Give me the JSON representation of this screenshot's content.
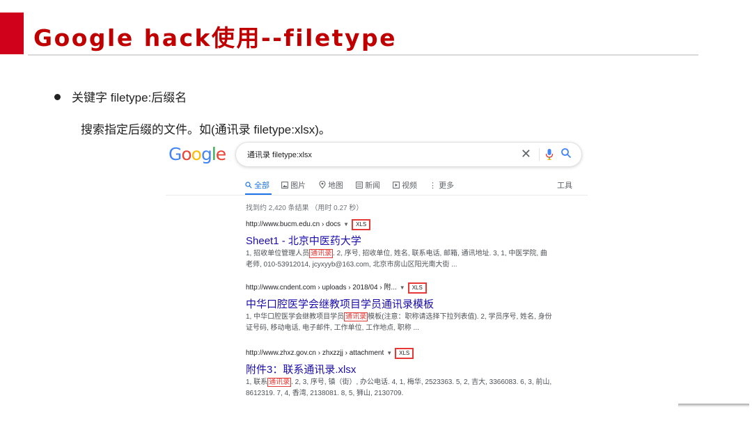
{
  "slide": {
    "title": "Google hack使用--filetype",
    "bullet": "关键字 filetype:后缀名",
    "description": "搜索指定后缀的文件。如(通讯录 filetype:xlsx)。"
  },
  "google": {
    "logo_letters": [
      {
        "ch": "G",
        "color": "#4285f4"
      },
      {
        "ch": "o",
        "color": "#ea4335"
      },
      {
        "ch": "o",
        "color": "#fbbc05"
      },
      {
        "ch": "g",
        "color": "#4285f4"
      },
      {
        "ch": "l",
        "color": "#34a853"
      },
      {
        "ch": "e",
        "color": "#ea4335"
      }
    ],
    "search": {
      "query": "通讯录 filetype:xlsx"
    },
    "tabs": [
      "全部",
      "图片",
      "地图",
      "新闻",
      "视频",
      "更多"
    ],
    "tab_icons": [
      "search-icon",
      "image-icon",
      "map-pin-icon",
      "news-icon",
      "video-icon",
      "more-icon"
    ],
    "tools": "工具",
    "stats": "找到约 2,420 条结果 （用时 0.27 秒）",
    "results": [
      {
        "url": "http://www.bucm.edu.cn › docs",
        "badge": "XLS",
        "title": "Sheet1 - 北京中医药大学",
        "snippet_before": "1, 招收单位管理人员",
        "snippet_highlight": "通讯录",
        "snippet_after": ". 2, 序号, 招收单位, 姓名, 联系电话, 邮箱, 通讯地址. 3, 1, 中医学院, 曲老师, 010-53912014, jcyxyyb@163.com, 北京市房山区阳光南大街 ..."
      },
      {
        "url": "http://www.cndent.com › uploads › 2018/04 › 附...",
        "badge": "XLS",
        "title": "中华口腔医学会继教项目学员通讯录模板",
        "snippet_before": "1, 中华口腔医学会继教项目学员",
        "snippet_highlight": "通讯录",
        "snippet_after": "模板(注意：职称请选择下拉列表值). 2, 学员序号, 姓名, 身份证号码, 移动电话, 电子邮件, 工作单位, 工作地点, 职称 ..."
      },
      {
        "url": "http://www.zhxz.gov.cn › zhxzzjj › attachment",
        "badge": "XLS",
        "title": "附件3：联系通讯录.xlsx",
        "snippet_before": "1, 联系",
        "snippet_highlight": "通讯录",
        "snippet_after": ". 2, 3, 序号, 镇（街）, 办公电话. 4, 1, 梅华, 2523363. 5, 2, 吉大, 3366083. 6, 3, 前山, 8612319. 7, 4, 香湾, 2138081. 8, 5, 狮山, 2130709."
      }
    ]
  },
  "colors": {
    "accent": "#d0021b",
    "title": "#c00000",
    "link": "#1a0dab",
    "active_tab": "#1a73e8",
    "highlight_box": "#e53935"
  }
}
